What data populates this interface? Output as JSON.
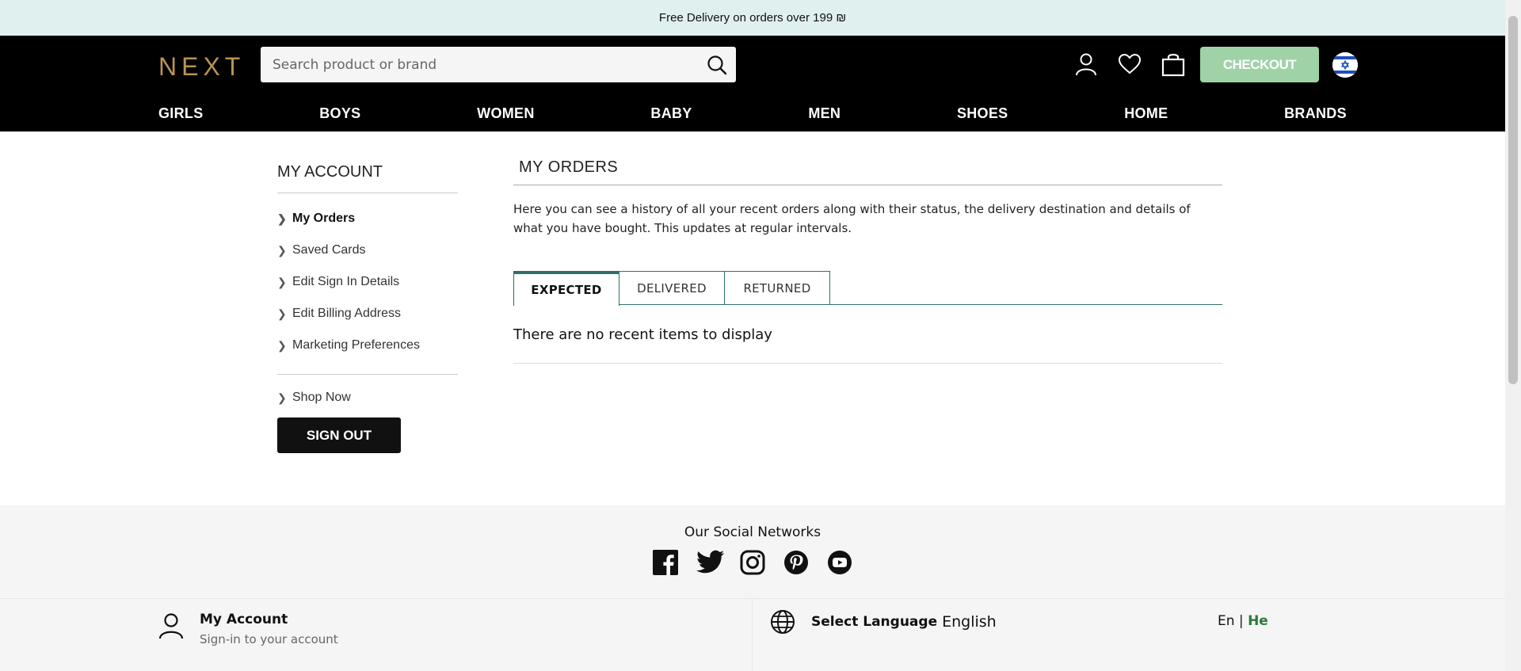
{
  "promo": {
    "text": "Free Delivery on orders over 199 ₪"
  },
  "header": {
    "logo": "NEXT",
    "search_placeholder": "Search product or brand",
    "checkout_label": "CHECKOUT",
    "nav": [
      "GIRLS",
      "BOYS",
      "WOMEN",
      "BABY",
      "MEN",
      "SHOES",
      "HOME",
      "BRANDS"
    ]
  },
  "sidebar": {
    "title": "MY ACCOUNT",
    "items": [
      {
        "label": "My Orders",
        "active": true
      },
      {
        "label": "Saved Cards"
      },
      {
        "label": "Edit Sign In Details"
      },
      {
        "label": "Edit Billing Address"
      },
      {
        "label": "Marketing Preferences"
      }
    ],
    "shop_now": "Shop Now",
    "sign_out": "SIGN OUT"
  },
  "main": {
    "title": "MY ORDERS",
    "intro": "Here you can see a history of all your recent orders along with their status, the delivery destination and details of what you have bought. This updates at regular intervals.",
    "tabs": [
      {
        "label": "EXPECTED",
        "active": true
      },
      {
        "label": "DELIVERED"
      },
      {
        "label": "RETURNED"
      }
    ],
    "empty_message": "There are no recent items to display"
  },
  "footer": {
    "social_title": "Our Social Networks",
    "social_icons": [
      "facebook-icon",
      "twitter-icon",
      "instagram-icon",
      "pinterest-icon",
      "youtube-icon"
    ],
    "account_title": "My Account",
    "account_sub": "Sign-in to your account",
    "language_label": "Select Language",
    "language_current": "English",
    "lang_en": "En",
    "lang_sep": "|",
    "lang_he": "He"
  },
  "colors": {
    "promo_bg": "#dff0ef",
    "header_bg": "#000000",
    "logo": "#b99251",
    "checkout_bg": "#9fd3a7",
    "tab_accent": "#2f6e6b",
    "lang_he": "#2b7a3a"
  }
}
